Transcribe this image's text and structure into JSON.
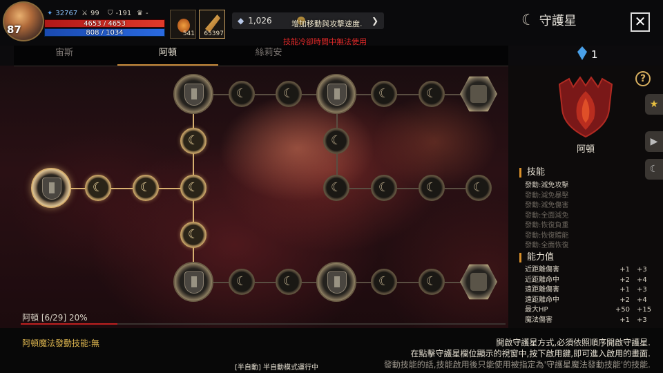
{
  "hud": {
    "level": "87",
    "power": "32767",
    "stat2": "99",
    "stat3": "-191",
    "stat4": "-",
    "hp": "4653 / 4653",
    "mp": "808 / 1034",
    "slot1_count": "541",
    "slot2_count": "65397",
    "currency1": "1,026",
    "notice_buff": "增加移動與攻擊速度.",
    "notice_cooldown": "技能冷卻時間中無法使用"
  },
  "panel": {
    "title": "守護星",
    "close_label": "✕",
    "gem_count": "1",
    "help_label": "?"
  },
  "tabs": [
    {
      "label": "宙斯",
      "active": false
    },
    {
      "label": "阿頓",
      "active": true
    },
    {
      "label": "絲莉安",
      "active": false
    }
  ],
  "progress": {
    "label": "阿頓 [6/29] 20%",
    "value": 0.2,
    "fill_color": "#c02020"
  },
  "star": {
    "name": "阿頓",
    "skills_title": "技能",
    "skills": [
      {
        "label": "發動:減免攻擊",
        "active": true
      },
      {
        "label": "發動:減免暴擊",
        "active": false
      },
      {
        "label": "發動:減免傷害",
        "active": false
      },
      {
        "label": "發動:全面減免",
        "active": false
      },
      {
        "label": "發動:恢復負重",
        "active": false
      },
      {
        "label": "發動:恢復體能",
        "active": false
      },
      {
        "label": "發動:全面恢復",
        "active": false
      }
    ],
    "abilities_title": "能力值",
    "abilities": [
      {
        "name": "近距離傷害",
        "v1": "+1",
        "v2": "+3"
      },
      {
        "name": "近距離命中",
        "v1": "+2",
        "v2": "+4"
      },
      {
        "name": "遠距離傷害",
        "v1": "+1",
        "v2": "+3"
      },
      {
        "name": "遠距離命中",
        "v1": "+2",
        "v2": "+4"
      },
      {
        "name": "最大HP",
        "v1": "+50",
        "v2": "+15"
      },
      {
        "name": "魔法傷害",
        "v1": "+1",
        "v2": "+3"
      }
    ]
  },
  "bottom": {
    "magic_skill": "阿頓魔法發動技能:無",
    "hint1": "開啟守護星方式,必須依照順序開啟守護星.",
    "hint2": "在點擊守護星欄位顯示的視窗中,按下啟用鍵,即可進入啟用的畫面.",
    "hint3": "發動技能的話,技能啟用後只能使用被指定為'守護星魔法發動技能'的技能.",
    "auto_mode": "[半自動] 半自動模式運行中"
  },
  "colors": {
    "accent": "#d8902a",
    "lit_gold": "#e0c080",
    "warning_red": "#e02a2a"
  }
}
